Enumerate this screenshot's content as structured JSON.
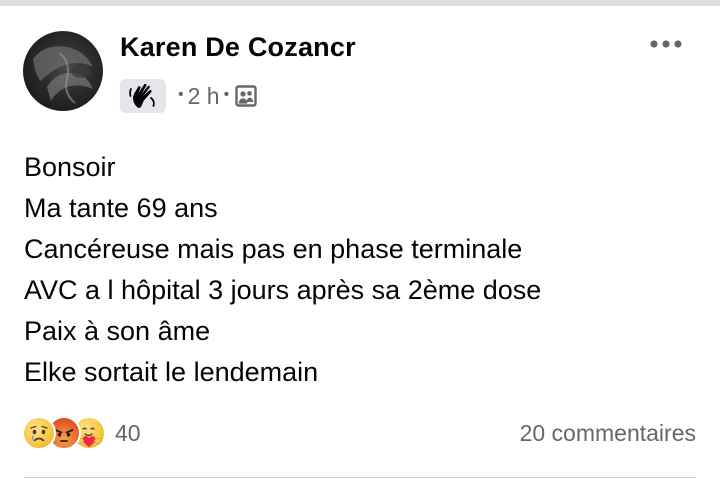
{
  "post": {
    "author": "Karen De Cozancr",
    "time": "2 h",
    "meta_separator": "•",
    "badge_icon": "waving-hand-icon",
    "audience_icon": "friends-audience-icon",
    "more_icon": "more-horizontal-icon",
    "message_lines": [
      "Bonsoir",
      "Ma tante 69 ans",
      "Cancéreuse mais pas en phase terminale",
      "AVC a l hôpital 3 jours après sa 2ème dose",
      "Paix à son âme",
      "Elke sortait le lendemain"
    ]
  },
  "footer": {
    "reactions": [
      "sad",
      "angry",
      "care"
    ],
    "reaction_count": "40",
    "comments": "20 commentaires"
  },
  "colors": {
    "text": "#050505",
    "secondary_text": "#65676b",
    "badge_bg": "#e4e6eb",
    "divider": "#dadde1"
  }
}
